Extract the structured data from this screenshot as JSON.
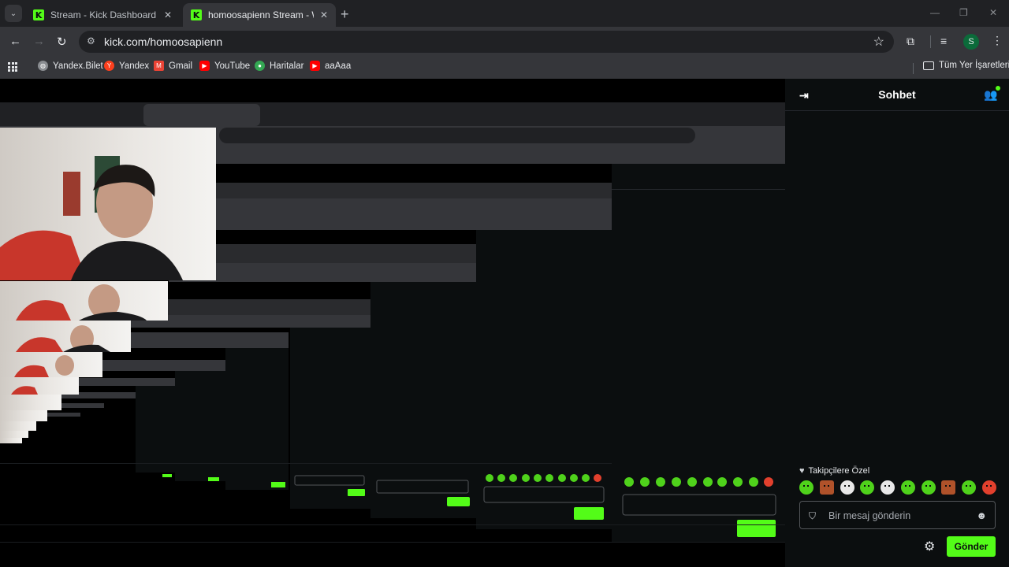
{
  "browser": {
    "tabs": [
      {
        "title": "Stream - Kick Dashboard",
        "favicon": "K",
        "active": false
      },
      {
        "title": "homoosapienn Stream - Watch",
        "favicon": "K",
        "active": true
      }
    ],
    "url": "kick.com/homoosapienn",
    "profile_initial": "S",
    "bookmarks": [
      {
        "label": "Yandex.Bilet",
        "icon": "globe-icon",
        "color": "#8a8d91"
      },
      {
        "label": "Yandex",
        "icon": "yandex-icon",
        "color": "#fc3f1d"
      },
      {
        "label": "Gmail",
        "icon": "gmail-icon",
        "color": "#ea4335"
      },
      {
        "label": "YouTube",
        "icon": "youtube-icon",
        "color": "#ff0000"
      },
      {
        "label": "Haritalar",
        "icon": "maps-icon",
        "color": "#34a853"
      },
      {
        "label": "aaAaa",
        "icon": "youtube-icon",
        "color": "#ff0000"
      }
    ],
    "all_bookmarks_label": "Tüm Yer İşaretleri"
  },
  "chat": {
    "title": "Sohbet",
    "subscriber_label": "Takipçilere Özel",
    "input_placeholder": "Bir mesaj gönderin",
    "send_label": "Gönder",
    "accent": "#53fc18",
    "emote_count": 10
  }
}
